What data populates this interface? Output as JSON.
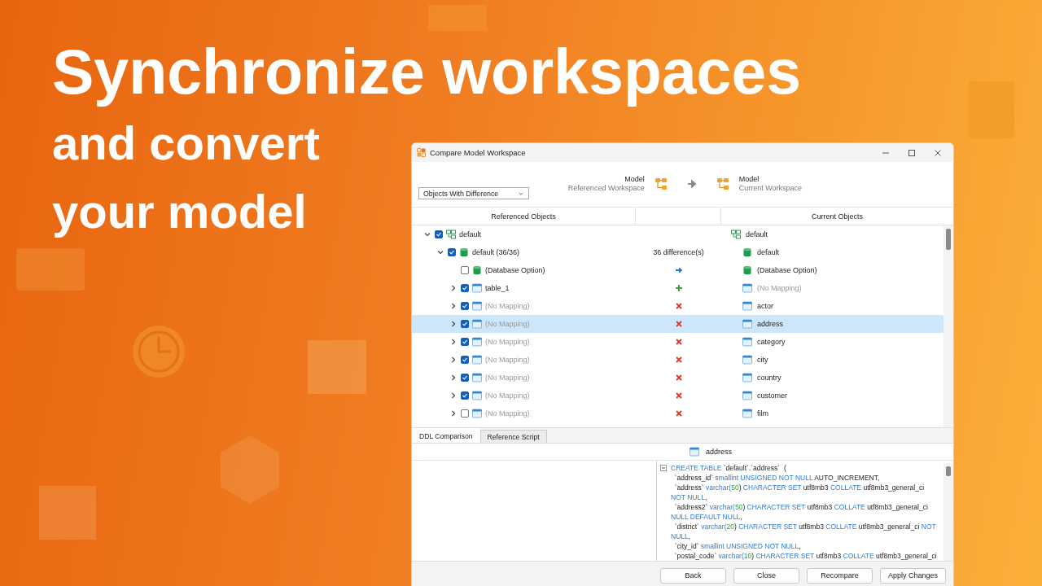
{
  "headline": {
    "line_1": "Synchronize workspaces",
    "line_2": "and convert",
    "line_3": "your model"
  },
  "window": {
    "title": "Compare Model Workspace"
  },
  "filter": {
    "value": "Objects With Difference"
  },
  "source": {
    "name": "Model",
    "workspace": "Referenced Workspace"
  },
  "target": {
    "name": "Model",
    "workspace": "Current Workspace"
  },
  "columns": [
    "Referenced Objects",
    "",
    "Current Objects"
  ],
  "tree": [
    {
      "kind": "schema",
      "expanded": true,
      "checked": true,
      "left": "default",
      "left_muted": false,
      "right": "default",
      "right_muted": false,
      "selected": false,
      "children": [
        {
          "kind": "database",
          "expanded": true,
          "checked": true,
          "left": "default (36/36)",
          "left_muted": false,
          "status": "36 difference(s)",
          "right": "default",
          "right_muted": false,
          "selected": false,
          "children": [
            {
              "kind": "option",
              "checked": false,
              "left": "(Database Option)",
              "left_muted": false,
              "right": "(Database Option)",
              "right_muted": false,
              "selected": false
            },
            {
              "kind": "added",
              "expanded": false,
              "checked": true,
              "left": "table_1",
              "left_muted": false,
              "right": "(No Mapping)",
              "right_muted": true,
              "selected": false
            },
            {
              "kind": "removed",
              "expanded": false,
              "checked": true,
              "left": "(No Mapping)",
              "left_muted": true,
              "right": "actor",
              "right_muted": false,
              "selected": false
            },
            {
              "kind": "removed",
              "expanded": false,
              "checked": true,
              "left": "(No Mapping)",
              "left_muted": true,
              "right": "address",
              "right_muted": false,
              "selected": true
            },
            {
              "kind": "removed",
              "expanded": false,
              "checked": true,
              "left": "(No Mapping)",
              "left_muted": true,
              "right": "category",
              "right_muted": false,
              "selected": false
            },
            {
              "kind": "removed",
              "expanded": false,
              "checked": true,
              "left": "(No Mapping)",
              "left_muted": true,
              "right": "city",
              "right_muted": false,
              "selected": false
            },
            {
              "kind": "removed",
              "expanded": false,
              "checked": true,
              "left": "(No Mapping)",
              "left_muted": true,
              "right": "country",
              "right_muted": false,
              "selected": false
            },
            {
              "kind": "removed",
              "expanded": false,
              "checked": true,
              "left": "(No Mapping)",
              "left_muted": true,
              "right": "customer",
              "right_muted": false,
              "selected": false
            },
            {
              "kind": "removed",
              "expanded": false,
              "checked": false,
              "left": "(No Mapping)",
              "left_muted": true,
              "right": "film",
              "right_muted": false,
              "selected": false
            }
          ]
        }
      ]
    }
  ],
  "tabs": [
    {
      "label": "DDL Comparison",
      "selected": true
    },
    {
      "label": "Reference Script",
      "selected": false
    }
  ],
  "ddl": {
    "object": "address",
    "code_lines": [
      [
        {
          "kind": "kw",
          "text": "CREATE TABLE"
        },
        {
          "kind": "plain",
          "text": " `default`.`address`  ("
        }
      ],
      [
        {
          "kind": "plain",
          "text": "  `address_id` "
        },
        {
          "kind": "kw",
          "text": "smallint UNSIGNED NOT NULL"
        },
        {
          "kind": "plain",
          "text": " AUTO_INCREMENT,"
        }
      ],
      [
        {
          "kind": "plain",
          "text": "  `address` "
        },
        {
          "kind": "kw",
          "text": "varchar("
        },
        {
          "kind": "num",
          "text": "50"
        },
        {
          "kind": "plain",
          "text": ") "
        },
        {
          "kind": "kw",
          "text": "CHARACTER SET"
        },
        {
          "kind": "plain",
          "text": " utf8mb3 "
        },
        {
          "kind": "kw",
          "text": "COLLATE"
        },
        {
          "kind": "plain",
          "text": " utf8mb3_general_ci"
        }
      ],
      [
        {
          "kind": "kw",
          "text": "NOT NULL"
        },
        {
          "kind": "plain",
          "text": ","
        }
      ],
      [
        {
          "kind": "plain",
          "text": "  `address2` "
        },
        {
          "kind": "kw",
          "text": "varchar("
        },
        {
          "kind": "num",
          "text": "50"
        },
        {
          "kind": "plain",
          "text": ") "
        },
        {
          "kind": "kw",
          "text": "CHARACTER SET"
        },
        {
          "kind": "plain",
          "text": " utf8mb3 "
        },
        {
          "kind": "kw",
          "text": "COLLATE"
        },
        {
          "kind": "plain",
          "text": " utf8mb3_general_ci"
        }
      ],
      [
        {
          "kind": "kw",
          "text": "NULL DEFAULT NULL"
        },
        {
          "kind": "plain",
          "text": ","
        }
      ],
      [
        {
          "kind": "plain",
          "text": "  `district` "
        },
        {
          "kind": "kw",
          "text": "varchar("
        },
        {
          "kind": "num",
          "text": "20"
        },
        {
          "kind": "plain",
          "text": ") "
        },
        {
          "kind": "kw",
          "text": "CHARACTER SET"
        },
        {
          "kind": "plain",
          "text": " utf8mb3 "
        },
        {
          "kind": "kw",
          "text": "COLLATE"
        },
        {
          "kind": "plain",
          "text": " utf8mb3_general_ci "
        },
        {
          "kind": "kw",
          "text": "NOT"
        }
      ],
      [
        {
          "kind": "kw",
          "text": "NULL"
        },
        {
          "kind": "plain",
          "text": ","
        }
      ],
      [
        {
          "kind": "plain",
          "text": "  `city_id` "
        },
        {
          "kind": "kw",
          "text": "smallint UNSIGNED NOT NULL"
        },
        {
          "kind": "plain",
          "text": ","
        }
      ],
      [
        {
          "kind": "plain",
          "text": "  `postal_code` "
        },
        {
          "kind": "kw",
          "text": "varchar("
        },
        {
          "kind": "num",
          "text": "10"
        },
        {
          "kind": "plain",
          "text": ") "
        },
        {
          "kind": "kw",
          "text": "CHARACTER SET"
        },
        {
          "kind": "plain",
          "text": " utf8mb3 "
        },
        {
          "kind": "kw",
          "text": "COLLATE"
        },
        {
          "kind": "plain",
          "text": " utf8mb3_general_ci"
        }
      ]
    ]
  },
  "buttons": [
    "Back",
    "Close",
    "Recompare",
    "Apply Changes"
  ]
}
